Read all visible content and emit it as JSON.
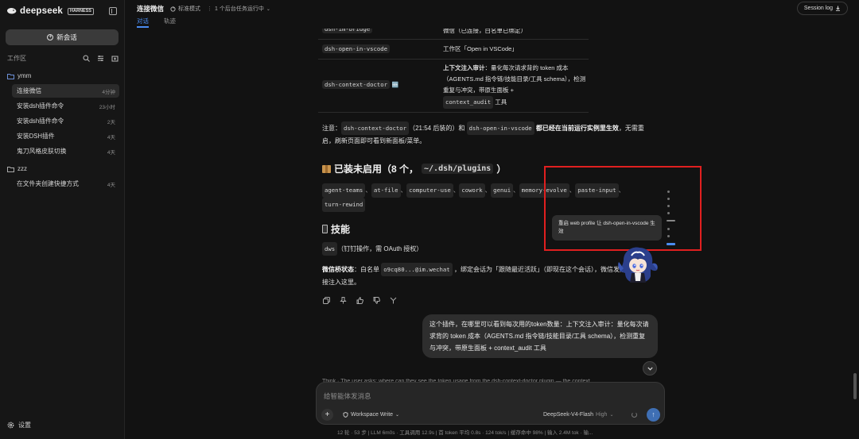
{
  "brand": {
    "name": "deepseek",
    "badge": "HARNESS"
  },
  "sidebar": {
    "new_chat": "新会话",
    "workspace_label": "工作区",
    "folders": [
      {
        "name": "ymm",
        "items": [
          {
            "title": "连接微信",
            "time": "4分钟"
          },
          {
            "title": "安装dsh插件命令",
            "time": "23小时"
          },
          {
            "title": "安装dsh插件命令",
            "time": "2天"
          },
          {
            "title": "安装DSH插件",
            "time": "4天"
          },
          {
            "title": "鬼刀风格皮肤切换",
            "time": "4天"
          }
        ]
      },
      {
        "name": "zzz",
        "items": [
          {
            "title": "在文件夹创建快捷方式",
            "time": "4天"
          }
        ]
      }
    ],
    "settings": "设置"
  },
  "header": {
    "title": "连接微信",
    "mode": "标准模式",
    "tasks": "1 个后台任务运行中",
    "tabs": [
      "对话",
      "轨迹"
    ],
    "session_log": "Session log"
  },
  "table_rows": [
    {
      "code": "dsh-im-bridge",
      "desc_pre": "",
      "desc_bold": "",
      "desc_post": "微信（已连接，白名单已绑定）",
      "code2": "",
      "desc_tail": ""
    },
    {
      "code": "dsh-open-in-vscode",
      "desc_pre": "",
      "desc_bold": "",
      "desc_post": "工作区「Open in VSCode」",
      "code2": "",
      "desc_tail": ""
    },
    {
      "code": "dsh-context-doctor",
      "desc_pre": "",
      "desc_bold": "上下文注入审计",
      "desc_post": "：量化每次请求背的 token 成本（AGENTS.md 指令链/技能目录/工具 schema），检测重复与冲突，带原生面板 +",
      "code2": "context_audit",
      "desc_tail": "工具"
    },
    {
      "new_badge": "🆕"
    }
  ],
  "note": {
    "prefix": "注意：",
    "code1": "dsh-context-doctor",
    "mid": "（21:54 后装的）和",
    "code2": "dsh-open-in-vscode",
    "bold": "都已经在当前运行实例里生效",
    "suffix": "，无需重启，刷新页面即可看到新面板/菜单。"
  },
  "plugins_heading": {
    "text": "已装未启用（8 个，",
    "code": "~/.dsh/plugins",
    "tail": "）"
  },
  "plugins": [
    "agent-teams",
    "at-file",
    "computer-use",
    "cowork",
    "genui",
    "memory-evolve",
    "paste-input",
    "turn-rewind"
  ],
  "plugin_sep": "、",
  "skills_heading": "技能",
  "skills": {
    "code": "dws",
    "text": "（钉钉操作，需 OAuth 授权）"
  },
  "wechat_status": {
    "label": "微信桥状态",
    "pre": "：白名单",
    "code": "o9cq80...@im.wechat",
    "post": "，绑定会话为「跟随最近活跃」（即现在这个会话），微信发消息会直接注入这里。"
  },
  "user_message": "这个插件，在哪里可以看到每次用的token数量：上下文注入审计：量化每次请求背的 token 成本（AGENTS.md 指令链/技能目录/工具 schema），检测重复与冲突，带原生面板 + context_audit 工具",
  "thinking": "Think · The user asks: where can they see the token usage from the dsh-context-doctor plugin — the context",
  "toast": "重启 web profile 让 dsh-open-in-vscode 生效",
  "composer": {
    "placeholder": "给智能体发消息",
    "workspace": "Workspace Write",
    "model": "DeepSeek-V4-Flash",
    "level": "High"
  },
  "status_bar": "12 轮 · 53 步  |  LLM 6m0s · 工具调用 12.9s  |  首 token 平均 0.8s · 124 tok/s  |  缓存命中 98%  |  输入 2.4M tok · 输..."
}
